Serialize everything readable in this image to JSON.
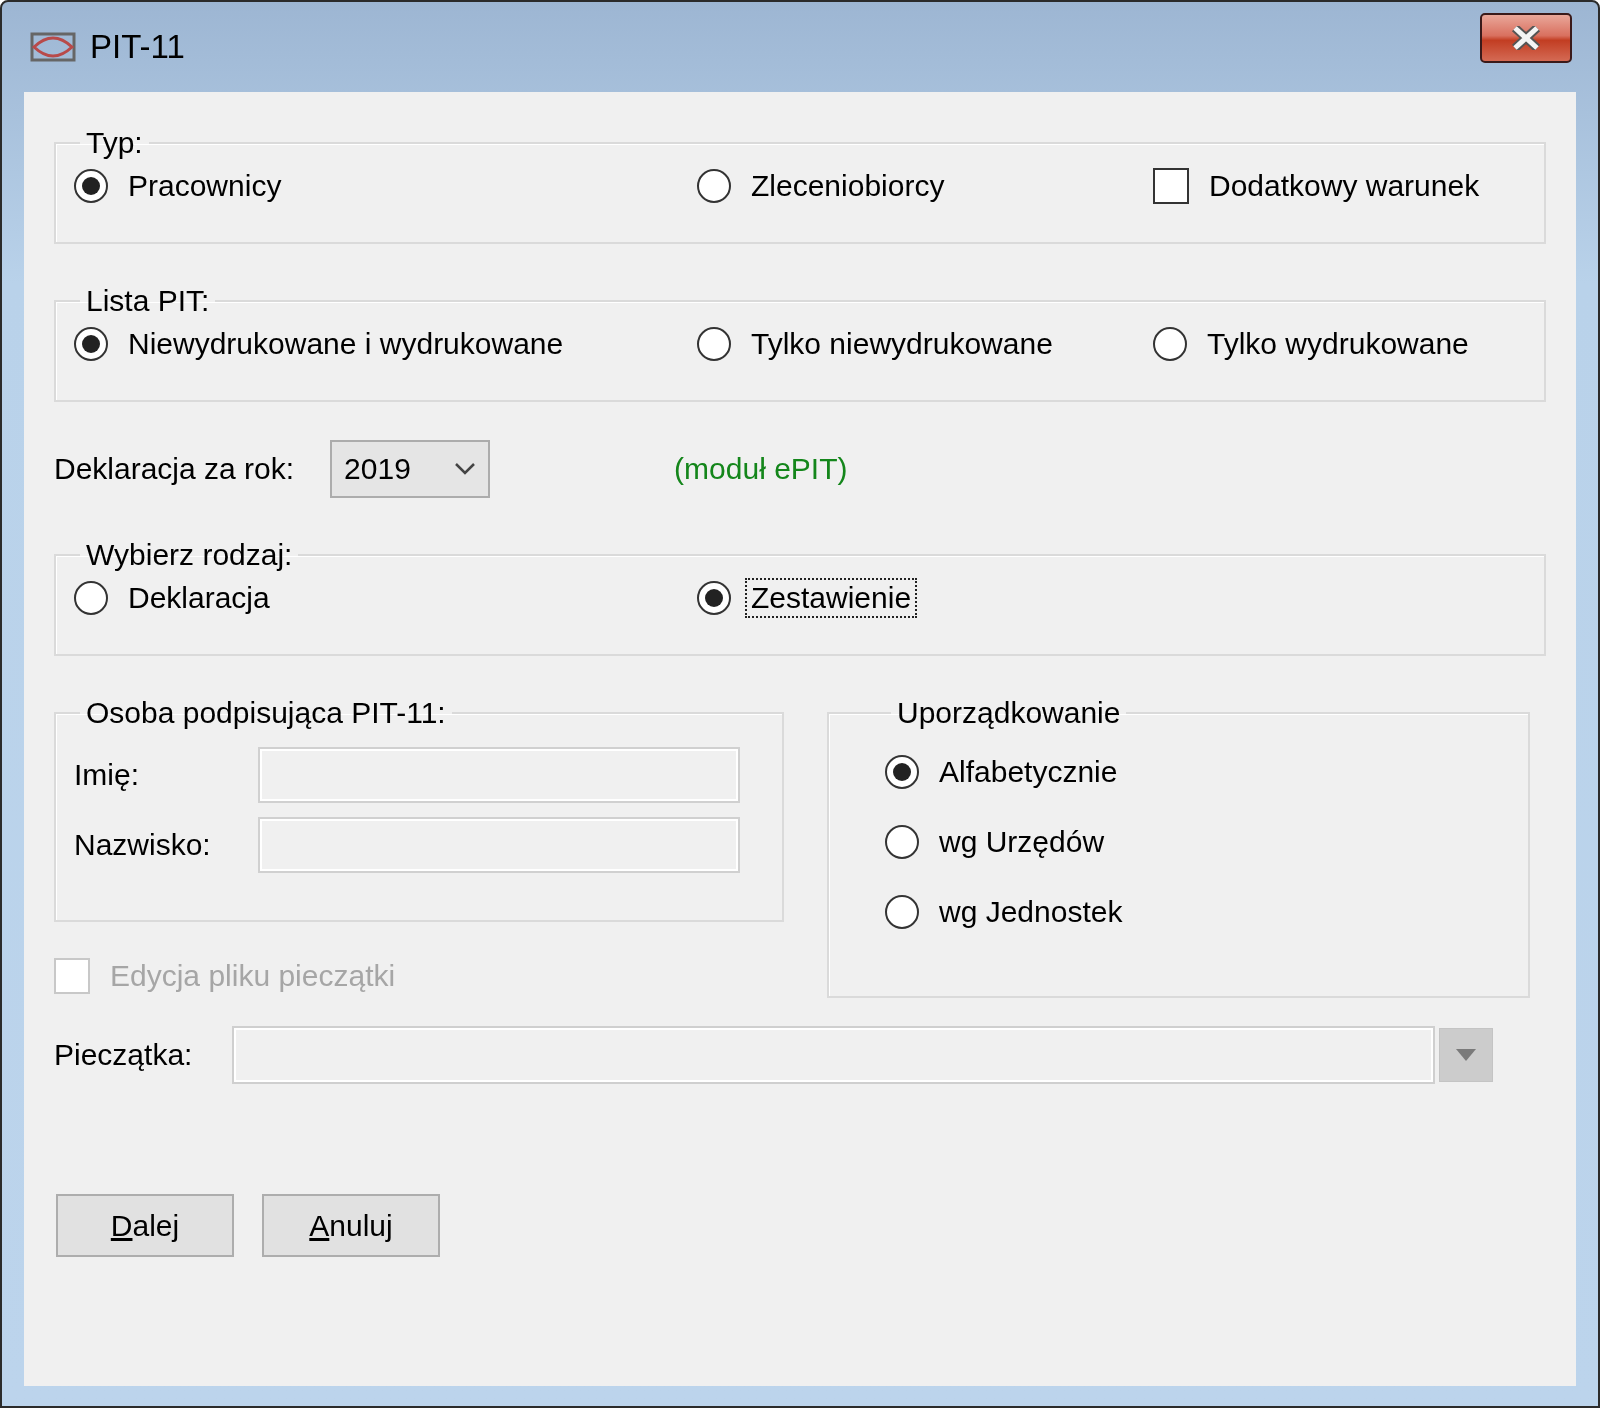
{
  "window": {
    "title": "PIT-11"
  },
  "typ": {
    "legend": "Typ:",
    "options": [
      {
        "kind": "radio",
        "label": "Pracownicy",
        "selected": true
      },
      {
        "kind": "radio",
        "label": "Zleceniobiorcy",
        "selected": false
      },
      {
        "kind": "checkbox",
        "label": "Dodatkowy warunek",
        "checked": false
      }
    ]
  },
  "lista_pit": {
    "legend": "Lista PIT:",
    "options": [
      {
        "kind": "radio",
        "label": "Niewydrukowane i wydrukowane",
        "selected": true
      },
      {
        "kind": "radio",
        "label": "Tylko niewydrukowane",
        "selected": false
      },
      {
        "kind": "radio",
        "label": "Tylko wydrukowane",
        "selected": false
      }
    ]
  },
  "deklaracja": {
    "label": "Deklaracja za rok:",
    "value": "2019",
    "note": "(moduł ePIT)"
  },
  "rodzaj": {
    "legend": "Wybierz rodzaj:",
    "options": [
      {
        "kind": "radio",
        "label": "Deklaracja",
        "selected": false,
        "focused": false
      },
      {
        "kind": "radio",
        "label": "Zestawienie",
        "selected": true,
        "focused": true
      }
    ]
  },
  "osoba": {
    "legend": "Osoba podpisująca PIT-11:",
    "fields": [
      {
        "label": "Imię:"
      },
      {
        "label": "Nazwisko:"
      }
    ]
  },
  "uporzadkowanie": {
    "legend": "Uporządkowanie",
    "options": [
      {
        "kind": "radio",
        "label": "Alfabetycznie",
        "selected": true
      },
      {
        "kind": "radio",
        "label": "wg Urzędów",
        "selected": false
      },
      {
        "kind": "radio",
        "label": "wg Jednostek",
        "selected": false
      }
    ]
  },
  "edycja": {
    "label": "Edycja pliku pieczątki",
    "checked": false,
    "disabled": true
  },
  "pieczatka": {
    "label": "Pieczątka:",
    "disabled": true
  },
  "buttons": [
    {
      "label": "Dalej",
      "mnemonic_underlined": true
    },
    {
      "label": "Anuluj",
      "mnemonic_underlined": true
    }
  ]
}
